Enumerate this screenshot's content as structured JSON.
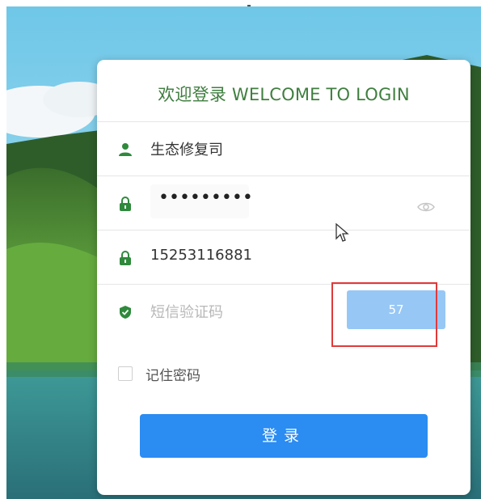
{
  "login": {
    "title": "欢迎登录 WELCOME TO LOGIN",
    "username_value": "生态修复司",
    "password_masked": "•••••••••",
    "phone_value": "15253116881",
    "sms_placeholder": "短信验证码",
    "sms_countdown": "57",
    "remember_label": "记住密码",
    "remember_checked": false,
    "submit_label": "登录"
  },
  "colors": {
    "accent_green": "#3f7e3f",
    "button_blue": "#2b8cf2",
    "sms_button_disabled": "#97c7f5",
    "highlight_red": "#e03a3a"
  },
  "icons": [
    "user-icon",
    "lock-icon",
    "eye-icon",
    "shield-icon",
    "checkbox"
  ]
}
